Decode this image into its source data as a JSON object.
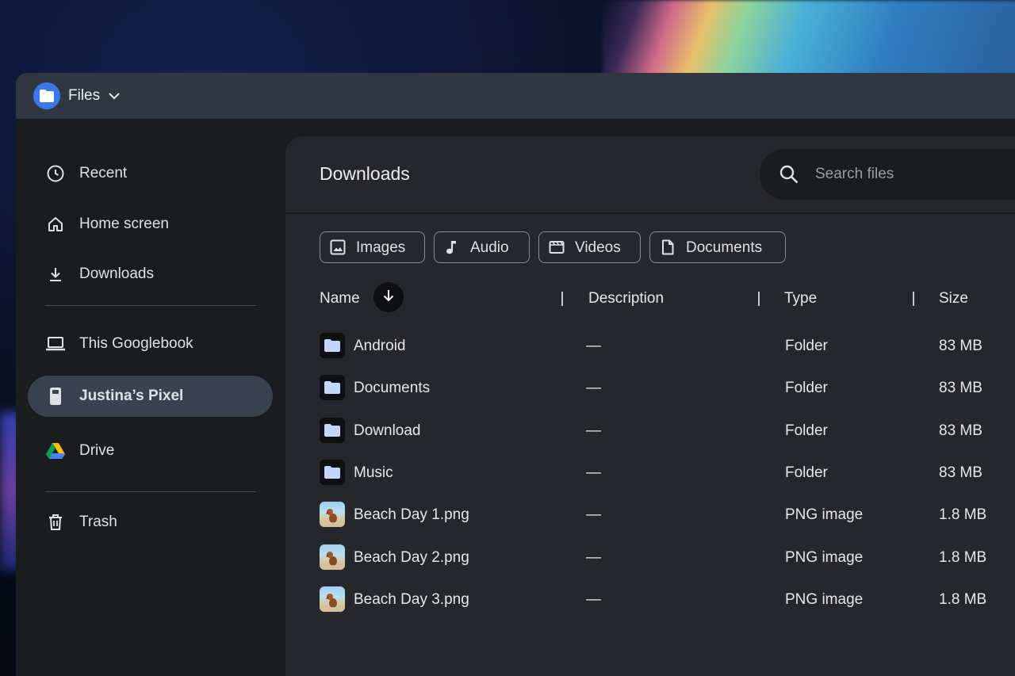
{
  "colors": {
    "accent": "#3b78e7",
    "folder_icon": "#c3d6ff",
    "titlebar": "#303743",
    "active_nav": "#3a4150",
    "main_bg": "#26272c"
  },
  "app": {
    "title": "Files",
    "icon": "folder-icon"
  },
  "sidebar": {
    "items": [
      {
        "label": "Recent",
        "icon": "clock-icon"
      },
      {
        "label": "Home screen",
        "icon": "home-icon"
      },
      {
        "label": "Downloads",
        "icon": "download-icon"
      },
      {
        "label": "This Googlebook",
        "icon": "laptop-icon"
      },
      {
        "label": "Justina’s Pixel",
        "icon": "phone-icon",
        "active": true
      },
      {
        "label": "Drive",
        "icon": "drive-icon"
      },
      {
        "label": "Trash",
        "icon": "trash-icon"
      }
    ]
  },
  "main": {
    "title": "Downloads",
    "search": {
      "placeholder": "Search files"
    },
    "chips": [
      {
        "label": "Images",
        "icon": "image-icon"
      },
      {
        "label": "Audio",
        "icon": "music-note-icon"
      },
      {
        "label": "Videos",
        "icon": "video-icon"
      },
      {
        "label": "Documents",
        "icon": "document-icon"
      }
    ],
    "columns": {
      "name": "Name",
      "description": "Description",
      "type": "Type",
      "size": "Size"
    },
    "rows": [
      {
        "name": "Android",
        "description": "—",
        "type": "Folder",
        "size": "83 MB",
        "kind": "folder"
      },
      {
        "name": "Documents",
        "description": "—",
        "type": "Folder",
        "size": "83 MB",
        "kind": "folder"
      },
      {
        "name": "Download",
        "description": "—",
        "type": "Folder",
        "size": "83 MB",
        "kind": "folder"
      },
      {
        "name": "Music",
        "description": "—",
        "type": "Folder",
        "size": "83 MB",
        "kind": "folder"
      },
      {
        "name": "Beach Day 1.png",
        "description": "—",
        "type": "PNG image",
        "size": "1.8 MB",
        "kind": "image"
      },
      {
        "name": "Beach Day 2.png",
        "description": "—",
        "type": "PNG image",
        "size": "1.8 MB",
        "kind": "image"
      },
      {
        "name": "Beach Day 3.png",
        "description": "—",
        "type": "PNG image",
        "size": "1.8 MB",
        "kind": "image"
      }
    ]
  }
}
